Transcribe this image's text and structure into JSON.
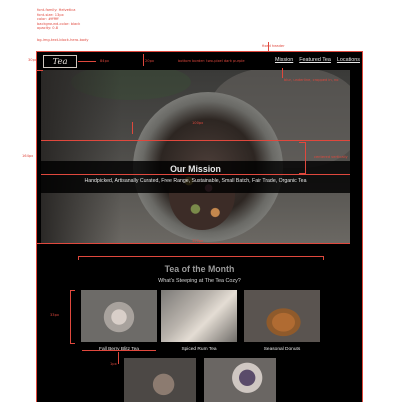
{
  "spec_notes": [
    "font-family: Helvetica",
    "font-size: 13px",
    "color: #ffffff",
    "background-color: black",
    "opacity: 0.8"
  ],
  "spec_css": "bg-img-text-block-hero-body",
  "annotations": {
    "fixed_header": "fixed header",
    "h_30px": "30px",
    "h_20px": "20px",
    "w_84px": "84px",
    "bottom_border": "bottom border: two-pixel dark purple",
    "blur_link": "blur, underline, cropped in, no",
    "h_164px": "164px",
    "centered_vertically": "centered vertically",
    "w_320px": "320px",
    "h_100px": "100px",
    "h_33px": "33px",
    "h_1px": "1px"
  },
  "header": {
    "logo": "Tea Cozy",
    "nav": [
      "Mission",
      "Featured Tea",
      "Locations"
    ]
  },
  "hero": {
    "title": "Our Mission",
    "text": "Handpicked, Artisanally Curated, Free Range, Sustainable, Small Batch, Fair Trade, Organic Tea"
  },
  "month": {
    "title": "Tea of the Month",
    "subtitle": "What's Steeping at The Tea Cozy?"
  },
  "teas": [
    {
      "name": "Fall Berry Blitz Tea"
    },
    {
      "name": "Spiced Rum Tea"
    },
    {
      "name": "Seasonal Donuts"
    }
  ],
  "colors": {
    "page_bg": "#000000",
    "annotation": "#e0483d",
    "text": "#ffffff"
  }
}
